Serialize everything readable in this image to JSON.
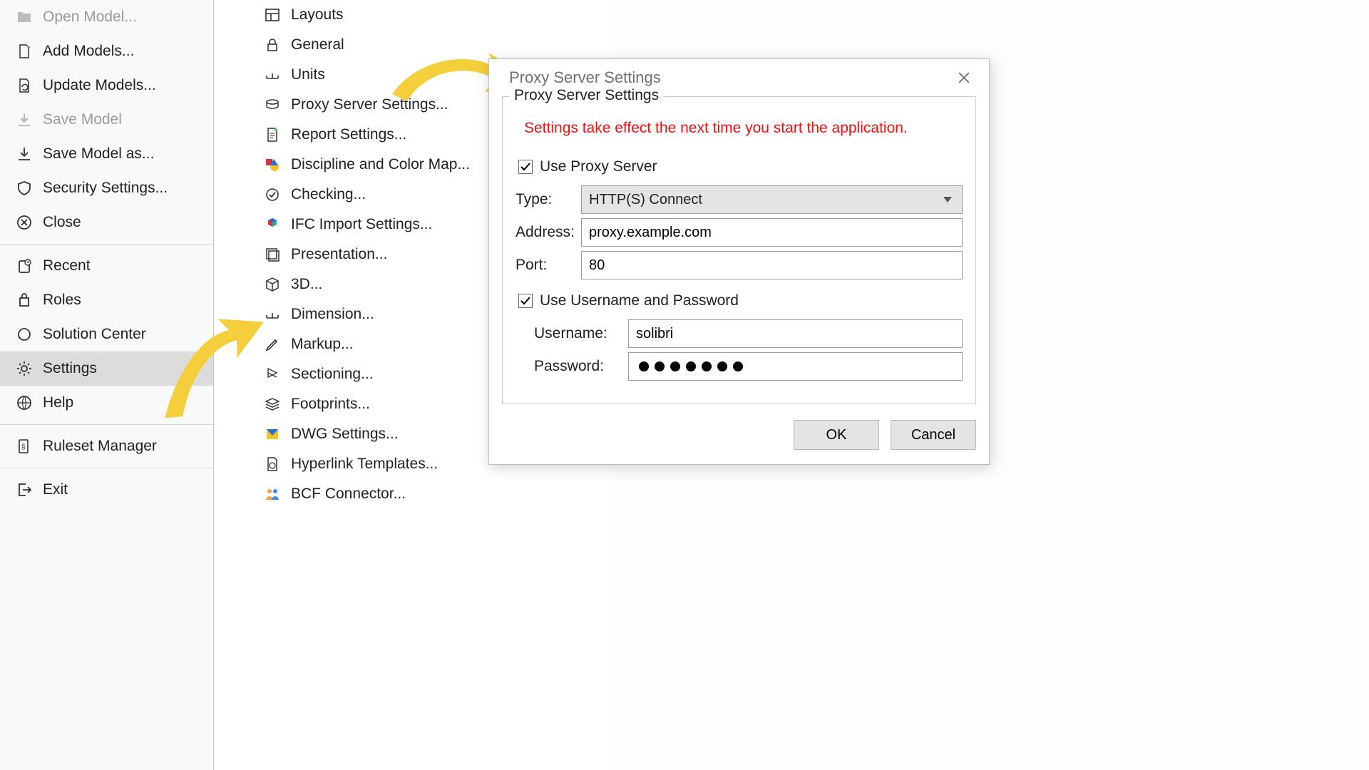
{
  "sidebar": {
    "items": [
      {
        "label": "Open Model...",
        "disabled": true
      },
      {
        "label": "Add Models..."
      },
      {
        "label": "Update Models..."
      },
      {
        "label": "Save Model",
        "disabled": true
      },
      {
        "label": "Save Model as..."
      },
      {
        "label": "Security Settings..."
      },
      {
        "label": "Close"
      }
    ],
    "group2": [
      {
        "label": "Recent"
      },
      {
        "label": "Roles"
      },
      {
        "label": "Solution Center"
      },
      {
        "label": "Settings",
        "selected": true
      },
      {
        "label": "Help"
      }
    ],
    "group3": [
      {
        "label": "Ruleset Manager"
      }
    ],
    "group4": [
      {
        "label": "Exit"
      }
    ]
  },
  "submenu": {
    "items": [
      {
        "label": "Layouts"
      },
      {
        "label": "General"
      },
      {
        "label": "Units"
      },
      {
        "label": "Proxy Server Settings..."
      },
      {
        "label": "Report Settings..."
      },
      {
        "label": "Discipline and Color Map..."
      },
      {
        "label": "Checking..."
      },
      {
        "label": "IFC Import Settings..."
      },
      {
        "label": "Presentation..."
      },
      {
        "label": "3D..."
      },
      {
        "label": "Dimension..."
      },
      {
        "label": "Markup..."
      },
      {
        "label": "Sectioning..."
      },
      {
        "label": "Footprints..."
      },
      {
        "label": "DWG Settings..."
      },
      {
        "label": "Hyperlink Templates..."
      },
      {
        "label": "BCF Connector..."
      }
    ]
  },
  "dialog": {
    "title": "Proxy Server Settings",
    "legend": "Proxy Server Settings",
    "notice": "Settings take effect the next time you start the application.",
    "useProxy_label": "Use Proxy Server",
    "useProxy_checked": true,
    "typeLabel": "Type:",
    "typeValue": "HTTP(S) Connect",
    "addressLabel": "Address:",
    "addressValue": "proxy.example.com",
    "portLabel": "Port:",
    "portValue": "80",
    "useAuth_label": "Use Username and Password",
    "useAuth_checked": true,
    "userLabel": "Username:",
    "userValue": "solibri",
    "passLabel": "Password:",
    "passDots": 7,
    "ok": "OK",
    "cancel": "Cancel"
  }
}
